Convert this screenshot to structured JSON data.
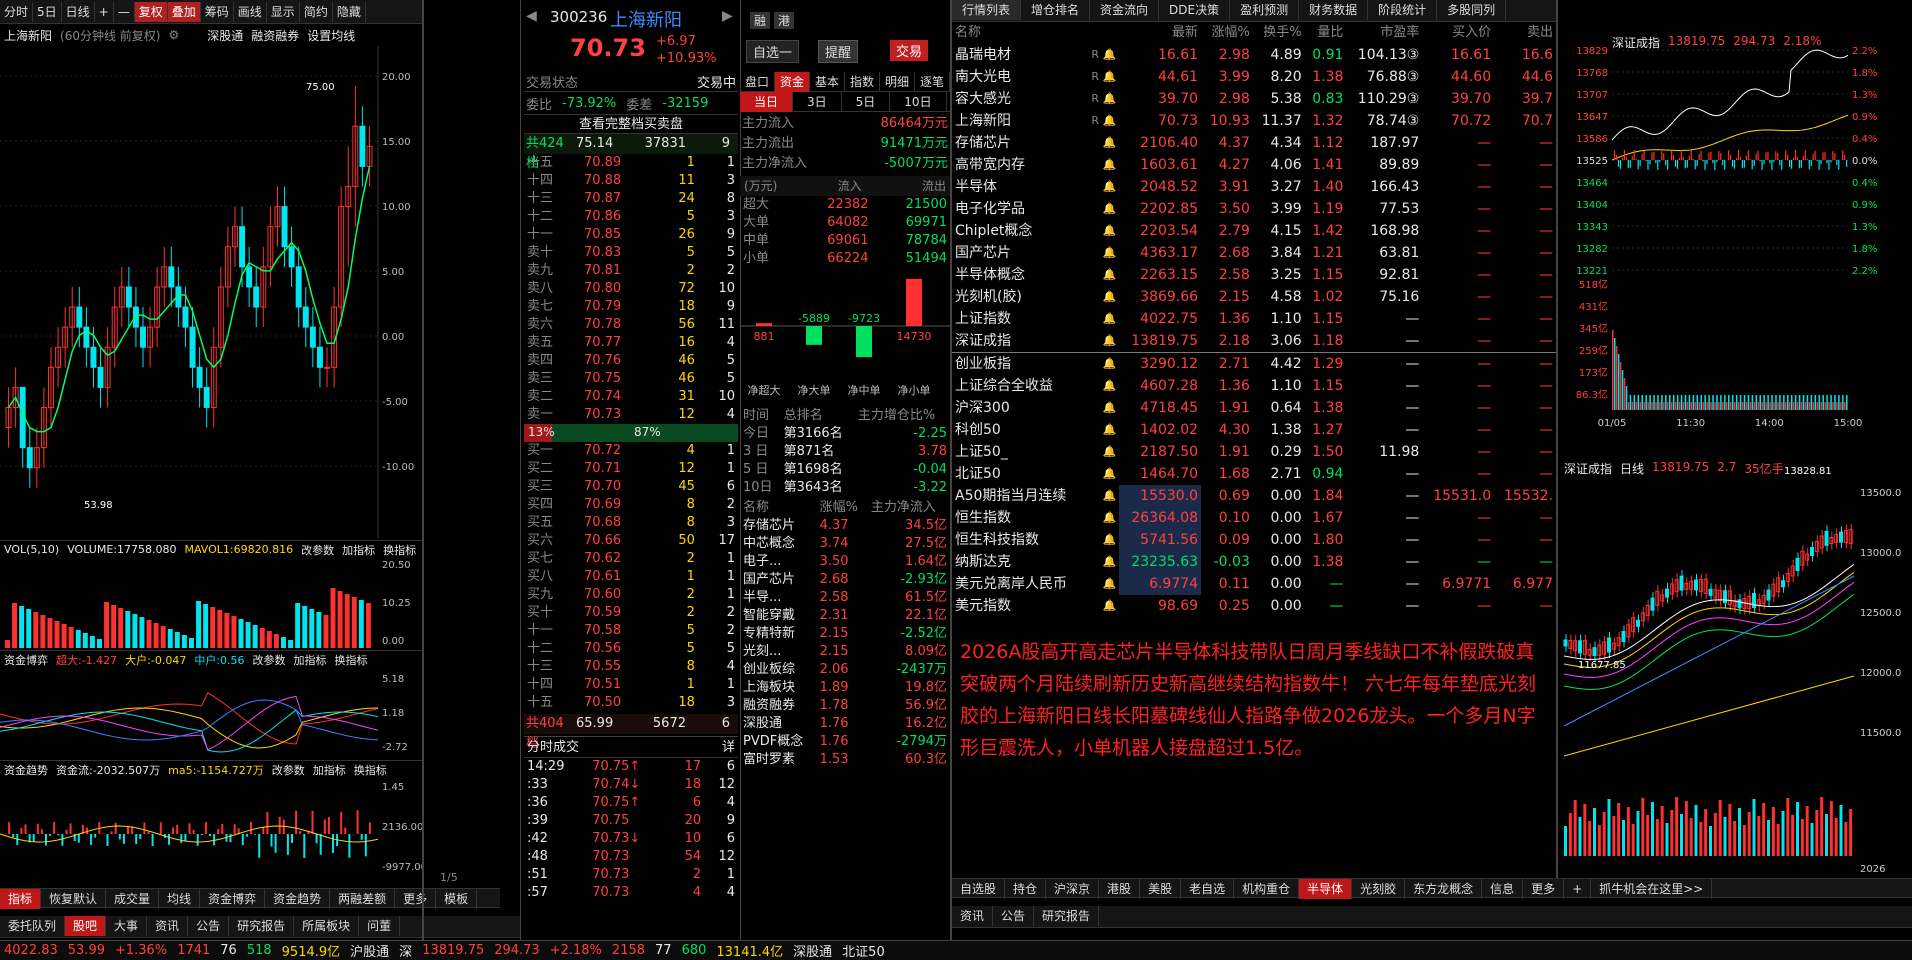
{
  "toolbar": {
    "items": [
      "分时",
      "5日",
      "日线",
      "+",
      "—",
      "复权",
      "叠加",
      "筹码",
      "画线",
      "显示",
      "简约",
      "隐藏"
    ]
  },
  "stock": {
    "code": "300236",
    "name": "上海新阳",
    "price": "70.73",
    "change": "+6.97",
    "pct": "+10.93%",
    "auto_select": "自选一",
    "remind": "提醒",
    "trade": "交易"
  },
  "chart_header": {
    "name": "上海新阳",
    "period": "(60分钟线 前复权)",
    "shen": "深股通",
    "rzrq": "融资融券",
    "setline": "设置均线"
  },
  "kline": {
    "high_label": "75.00",
    "low_label": "53.98",
    "pct_ticks": [
      "20.00",
      "15.00",
      "10.00",
      "5.00",
      "0.00",
      "-5.00",
      "-10.00"
    ],
    "candles": [
      [
        58,
        60,
        57,
        59
      ],
      [
        59,
        61,
        58,
        60
      ],
      [
        60,
        60,
        56,
        57
      ],
      [
        57,
        58,
        55,
        56
      ],
      [
        56,
        58,
        55,
        57
      ],
      [
        57,
        60,
        56,
        59
      ],
      [
        59,
        62,
        58,
        61
      ],
      [
        61,
        63,
        60,
        62
      ],
      [
        62,
        64,
        61,
        63
      ],
      [
        63,
        65,
        62,
        64
      ],
      [
        64,
        65,
        62,
        63
      ],
      [
        63,
        64,
        61,
        62
      ],
      [
        62,
        63,
        60,
        61
      ],
      [
        61,
        62,
        59,
        60
      ],
      [
        60,
        63,
        59,
        62
      ],
      [
        62,
        65,
        61,
        64
      ],
      [
        64,
        66,
        63,
        65
      ],
      [
        65,
        66,
        63,
        64
      ],
      [
        64,
        65,
        62,
        63
      ],
      [
        63,
        64,
        61,
        62
      ],
      [
        62,
        64,
        61,
        63
      ],
      [
        63,
        66,
        62,
        65
      ],
      [
        65,
        67,
        64,
        66
      ],
      [
        66,
        67,
        64,
        65
      ],
      [
        65,
        66,
        63,
        64
      ],
      [
        64,
        65,
        62,
        63
      ],
      [
        63,
        64,
        60,
        61
      ],
      [
        61,
        62,
        59,
        60
      ],
      [
        60,
        61,
        58,
        59
      ],
      [
        59,
        63,
        58,
        62
      ],
      [
        62,
        66,
        61,
        65
      ],
      [
        65,
        68,
        64,
        67
      ],
      [
        67,
        69,
        66,
        68
      ],
      [
        68,
        69,
        65,
        66
      ],
      [
        66,
        67,
        64,
        65
      ],
      [
        65,
        66,
        63,
        64
      ],
      [
        64,
        67,
        63,
        66
      ],
      [
        66,
        69,
        65,
        68
      ],
      [
        68,
        70,
        67,
        69
      ],
      [
        69,
        70,
        66,
        67
      ],
      [
        67,
        68,
        65,
        66
      ],
      [
        66,
        67,
        63,
        64
      ],
      [
        64,
        65,
        62,
        63
      ],
      [
        63,
        64,
        61,
        62
      ],
      [
        62,
        63,
        60,
        61
      ],
      [
        61,
        62,
        60,
        61
      ],
      [
        61,
        65,
        60,
        64
      ],
      [
        64,
        70,
        63,
        69
      ],
      [
        69,
        72,
        66,
        70
      ],
      [
        70,
        75,
        68,
        73
      ],
      [
        73,
        74,
        70,
        71
      ],
      [
        71,
        73,
        70,
        72
      ]
    ]
  },
  "vol_header": {
    "label": "VOL(5,10)",
    "volume": "VOLUME:17758.080",
    "mavol": "MAVOL1:69820.816",
    "param": "改参数",
    "add": "加指标",
    "swap": "换指标",
    "ticks": [
      "20.50",
      "10.25",
      "0.00"
    ]
  },
  "game_header": {
    "label": "资金博弈",
    "super": "超大:-1.427",
    "big": "大户:-0.047",
    "mid": "中户:0.56",
    "param": "改参数",
    "add": "加指标",
    "swap": "换指标",
    "ticks": [
      "5.18",
      "1.18",
      "-2.72"
    ]
  },
  "trend_header": {
    "label": "资金趋势",
    "flow": "资金流:-2032.507万",
    "ma5": "ma5:-1154.727万",
    "param": "改参数",
    "add": "加指标",
    "swap": "换指标",
    "ticks": [
      "1.45",
      "2136.00",
      "-9977.00"
    ]
  },
  "page_ind": "1/5",
  "bottom_tabs": [
    "指标",
    "恢复默认",
    "成交量",
    "均线",
    "资金博弈",
    "资金趋势",
    "两融差额",
    "更多",
    "模板"
  ],
  "lower_tabs": [
    "委托队列",
    "股吧",
    "大事",
    "资讯",
    "公告",
    "研究报告",
    "所属板块",
    "问董"
  ],
  "status": {
    "a": "4022.83",
    "b": "53.99",
    "c": "+1.36%",
    "d": "1741",
    "e": "76",
    "f": "518",
    "g": "9514.9亿",
    "h": "沪股通",
    "i": "深",
    "j": "13819.75",
    "k": "294.73",
    "l": "+2.18%",
    "m": "2158",
    "n": "77",
    "o": "680",
    "p": "13141.4亿",
    "q": "深股通",
    "r": "北证50"
  },
  "orderbook": {
    "state_label": "交易状态",
    "state": "交易中",
    "ratio_label": "委比",
    "ratio": "-73.92%",
    "diff_label": "委差",
    "diff": "-32159",
    "full": "查看完整档买卖盘",
    "sell_total": "共424档",
    "sell_total_p": "75.14",
    "sell_total_v": "37831",
    "sell_total_n": "9",
    "sells": [
      [
        "十五",
        "70.89",
        "1",
        "1"
      ],
      [
        "十四",
        "70.88",
        "11",
        "3"
      ],
      [
        "十三",
        "70.87",
        "24",
        "8"
      ],
      [
        "十二",
        "70.86",
        "5",
        "3"
      ],
      [
        "十一",
        "70.85",
        "26",
        "9"
      ],
      [
        "卖十",
        "70.83",
        "5",
        "5"
      ],
      [
        "卖九",
        "70.81",
        "2",
        "2"
      ],
      [
        "卖八",
        "70.80",
        "72",
        "10"
      ],
      [
        "卖七",
        "70.79",
        "18",
        "9"
      ],
      [
        "卖六",
        "70.78",
        "56",
        "11"
      ],
      [
        "卖五",
        "70.77",
        "16",
        "4"
      ],
      [
        "卖四",
        "70.76",
        "46",
        "5"
      ],
      [
        "卖三",
        "70.75",
        "46",
        "5"
      ],
      [
        "卖二",
        "70.74",
        "31",
        "10"
      ],
      [
        "卖一",
        "70.73",
        "12",
        "4"
      ]
    ],
    "ratio_bar": {
      "left": "13%",
      "right": "87%",
      "buy_frac": 0.13
    },
    "buys": [
      [
        "买一",
        "70.72",
        "4",
        "1"
      ],
      [
        "买二",
        "70.71",
        "12",
        "1"
      ],
      [
        "买三",
        "70.70",
        "45",
        "6"
      ],
      [
        "买四",
        "70.69",
        "8",
        "2"
      ],
      [
        "买五",
        "70.68",
        "8",
        "3"
      ],
      [
        "买六",
        "70.66",
        "50",
        "17"
      ],
      [
        "买七",
        "70.62",
        "2",
        "1"
      ],
      [
        "买八",
        "70.61",
        "1",
        "1"
      ],
      [
        "买九",
        "70.60",
        "2",
        "1"
      ],
      [
        "买十",
        "70.59",
        "2",
        "2"
      ],
      [
        "十一",
        "70.58",
        "5",
        "2"
      ],
      [
        "十二",
        "70.56",
        "5",
        "5"
      ],
      [
        "十三",
        "70.55",
        "8",
        "4"
      ],
      [
        "十四",
        "70.51",
        "1",
        "1"
      ],
      [
        "十五",
        "70.50",
        "18",
        "3"
      ]
    ],
    "buy_total": "共404档",
    "buy_total_p": "65.99",
    "buy_total_v": "5672",
    "buy_total_n": "6"
  },
  "ticks_panel": {
    "title": "分时成交",
    "detail": "详",
    "rows": [
      [
        "14:29",
        "70.75",
        "↑",
        "17",
        "6"
      ],
      [
        ":33",
        "70.74",
        "↓",
        "18",
        "12"
      ],
      [
        ":36",
        "70.75",
        "↑",
        "6",
        "4"
      ],
      [
        ":39",
        "70.75",
        "",
        "20",
        "9"
      ],
      [
        ":42",
        "70.73",
        "↓",
        "10",
        "6"
      ],
      [
        ":48",
        "70.73",
        "",
        "54",
        "12"
      ],
      [
        ":51",
        "70.73",
        "",
        "2",
        "1"
      ],
      [
        ":57",
        "70.73",
        "",
        "4",
        "4"
      ]
    ]
  },
  "fund_tabs": [
    "盘口",
    "资金",
    "基本",
    "指数",
    "明细",
    "逐笔"
  ],
  "fund_subtabs": [
    "当日",
    "3日",
    "5日",
    "10日"
  ],
  "fund": {
    "in_label": "主力流入",
    "in": "86464万元",
    "out_label": "主力流出",
    "out": "91471万元",
    "net_label": "主力净流入",
    "net": "-5007万元",
    "unit": "(万元)",
    "col_in": "流入",
    "col_out": "流出",
    "rows": [
      [
        "超大",
        "22382",
        "21500"
      ],
      [
        "大单",
        "64082",
        "69971"
      ],
      [
        "中单",
        "69061",
        "78784"
      ],
      [
        "小单",
        "66224",
        "51494"
      ]
    ],
    "bars": [
      {
        "v": 881,
        "label": "881"
      },
      {
        "v": -5889,
        "label": "-5889"
      },
      {
        "v": -9723,
        "label": "-9723"
      },
      {
        "v": 14730,
        "label": "14730"
      }
    ],
    "bar_names": [
      "净超大",
      "净大单",
      "净中单",
      "净小单"
    ],
    "rank_h": [
      "时间",
      "总排名",
      "主力增仓比%"
    ],
    "rank": [
      [
        "今日",
        "第3166名",
        "-2.25"
      ],
      [
        "3 日",
        "第871名",
        "3.78"
      ],
      [
        "5 日",
        "第1698名",
        "-0.04"
      ],
      [
        "10日",
        "第3643名",
        "-3.22"
      ]
    ],
    "sector_h": [
      "名称",
      "涨幅%",
      "主力净流入"
    ],
    "sectors": [
      [
        "存储芯片",
        "4.37",
        "34.5亿"
      ],
      [
        "中芯概念",
        "3.74",
        "27.5亿"
      ],
      [
        "电子...",
        "3.50",
        "1.64亿"
      ],
      [
        "国产芯片",
        "2.68",
        "-2.93亿"
      ],
      [
        "半导...",
        "2.58",
        "61.5亿"
      ],
      [
        "智能穿戴",
        "2.31",
        "22.1亿"
      ],
      [
        "专精特新",
        "2.15",
        "-2.52亿"
      ],
      [
        "光刻...",
        "2.15",
        "8.09亿"
      ],
      [
        "创业板综",
        "2.06",
        "-2437万"
      ],
      [
        "上海板块",
        "1.89",
        "19.8亿"
      ],
      [
        "融资融券",
        "1.78",
        "56.9亿"
      ],
      [
        "深股通",
        "1.76",
        "16.2亿"
      ],
      [
        "PVDF概念",
        "1.76",
        "-2794万"
      ],
      [
        "富时罗素",
        "1.53",
        "60.3亿"
      ]
    ]
  },
  "market_tabs": [
    "行情列表",
    "增仓排名",
    "资金流向",
    "DDE决策",
    "盈利预测",
    "财务数据",
    "阶段统计",
    "多股同列"
  ],
  "list_head": [
    "名称",
    "",
    "最新",
    "涨幅%",
    "换手%",
    "量比",
    "市盈率",
    "买入价",
    "卖出"
  ],
  "list": [
    [
      "晶瑞电材",
      "R",
      "16.61",
      "2.98",
      "4.89",
      "0.91",
      "104.13③",
      "16.61",
      "16.6"
    ],
    [
      "南大光电",
      "R",
      "44.61",
      "3.99",
      "8.20",
      "1.38",
      "76.88③",
      "44.60",
      "44.6"
    ],
    [
      "容大感光",
      "R",
      "39.70",
      "2.98",
      "5.38",
      "0.83",
      "110.29③",
      "39.70",
      "39.7"
    ],
    [
      "上海新阳",
      "R",
      "70.73",
      "10.93",
      "11.37",
      "1.32",
      "78.74③",
      "70.72",
      "70.7"
    ],
    [
      "存储芯片",
      "",
      "2106.40",
      "4.37",
      "4.34",
      "1.12",
      "187.97",
      "—",
      "—"
    ],
    [
      "高带宽内存",
      "",
      "1603.61",
      "4.27",
      "4.06",
      "1.41",
      "89.89",
      "—",
      "—"
    ],
    [
      "半导体",
      "",
      "2048.52",
      "3.91",
      "3.27",
      "1.40",
      "166.43",
      "—",
      "—"
    ],
    [
      "电子化学品",
      "",
      "2202.85",
      "3.50",
      "3.99",
      "1.19",
      "77.53",
      "—",
      "—"
    ],
    [
      "Chiplet概念",
      "",
      "2203.54",
      "2.79",
      "4.15",
      "1.42",
      "168.98",
      "—",
      "—"
    ],
    [
      "国产芯片",
      "",
      "4363.17",
      "2.68",
      "3.84",
      "1.21",
      "63.81",
      "—",
      "—"
    ],
    [
      "半导体概念",
      "",
      "2263.15",
      "2.58",
      "3.25",
      "1.15",
      "92.81",
      "—",
      "—"
    ],
    [
      "光刻机(胶)",
      "",
      "3869.66",
      "2.15",
      "4.58",
      "1.02",
      "75.16",
      "—",
      "—"
    ],
    [
      "上证指数",
      "",
      "4022.75",
      "1.36",
      "1.10",
      "1.15",
      "—",
      "—",
      "—"
    ],
    [
      "深证成指",
      "",
      "13819.75",
      "2.18",
      "3.06",
      "1.18",
      "—",
      "—",
      "—"
    ],
    [
      "创业板指",
      "",
      "3290.12",
      "2.71",
      "4.42",
      "1.29",
      "—",
      "—",
      "—"
    ],
    [
      "上证综合全收益",
      "",
      "4607.28",
      "1.36",
      "1.10",
      "1.15",
      "—",
      "—",
      "—"
    ],
    [
      "沪深300",
      "",
      "4718.45",
      "1.91",
      "0.64",
      "1.38",
      "—",
      "—",
      "—"
    ],
    [
      "科创50",
      "",
      "1402.02",
      "4.30",
      "1.38",
      "1.27",
      "—",
      "—",
      "—"
    ],
    [
      "上证50_",
      "",
      "2187.50",
      "1.91",
      "0.29",
      "1.50",
      "11.98",
      "—",
      "—"
    ],
    [
      "北证50",
      "",
      "1464.70",
      "1.68",
      "2.71",
      "0.94",
      "—",
      "—",
      "—"
    ],
    [
      "A50期指当月连续",
      "",
      "15530.0",
      "0.69",
      "0.00",
      "1.84",
      "—",
      "15531.0",
      "15532."
    ],
    [
      "恒生指数",
      "",
      "26364.08",
      "0.10",
      "0.00",
      "1.67",
      "—",
      "—",
      "—"
    ],
    [
      "恒生科技指数",
      "",
      "5741.56",
      "0.09",
      "0.00",
      "1.80",
      "—",
      "—",
      "—"
    ],
    [
      "纳斯达克",
      "",
      "23235.63",
      "-0.03",
      "0.00",
      "1.38",
      "—",
      "—",
      "—"
    ],
    [
      "美元兑离岸人民币",
      "",
      "6.9774",
      "0.11",
      "0.00",
      "—",
      "—",
      "6.9771",
      "6.977"
    ],
    [
      "美元指数",
      "",
      "98.69",
      "0.25",
      "0.00",
      "—",
      "—",
      "—",
      "—"
    ]
  ],
  "comment": "2026A股高开高走芯片半导体科技带队日周月季线缺口不补假跌破真突破两个月陆续刷新历史新高继续结构指数牛！  六七年每年垫底光刻胶的上海新阳日线长阳墓碑线仙人指路争做2026龙头。一个多月N字形巨震洗人，小单机器人接盘超过1.5亿。",
  "sector_tabs": [
    "自选股",
    "持仓",
    "沪深京",
    "港股",
    "美股",
    "老自选",
    "机构重仓",
    "半导体",
    "光刻胶",
    "东方龙概念",
    "信息",
    "更多",
    "+",
    "抓牛机会在这里>>"
  ],
  "sector_tabs2": [
    "资讯",
    "公告",
    "研究报告"
  ],
  "index_min": {
    "title": "深证成指",
    "value": "13819.75",
    "chg": "294.73",
    "pct": "2.18%",
    "y_left": [
      "13829",
      "13768",
      "13707",
      "13647",
      "13586",
      "13525",
      "13464",
      "13404",
      "13343",
      "13282",
      "13221"
    ],
    "y_right": [
      "2.2%",
      "1.8%",
      "1.3%",
      "0.9%",
      "0.4%",
      "0.0%",
      "0.4%",
      "0.9%",
      "1.3%",
      "1.8%",
      "2.2%"
    ],
    "vol_ticks": [
      "518亿",
      "431亿",
      "345亿",
      "259亿",
      "173亿",
      "86.3亿"
    ],
    "times": [
      "01/05",
      "11:30",
      "14:00",
      "15:00"
    ]
  },
  "index_day": {
    "title": "深证成指",
    "period": "日线",
    "value": "13819.75",
    "chg": "2.7",
    "pct": "35亿手",
    "high": "13828.81",
    "low": "11677.85",
    "y": [
      "13500.0",
      "13000.0",
      "12500.0",
      "12000.0",
      "11500.0"
    ],
    "year": "2026"
  }
}
